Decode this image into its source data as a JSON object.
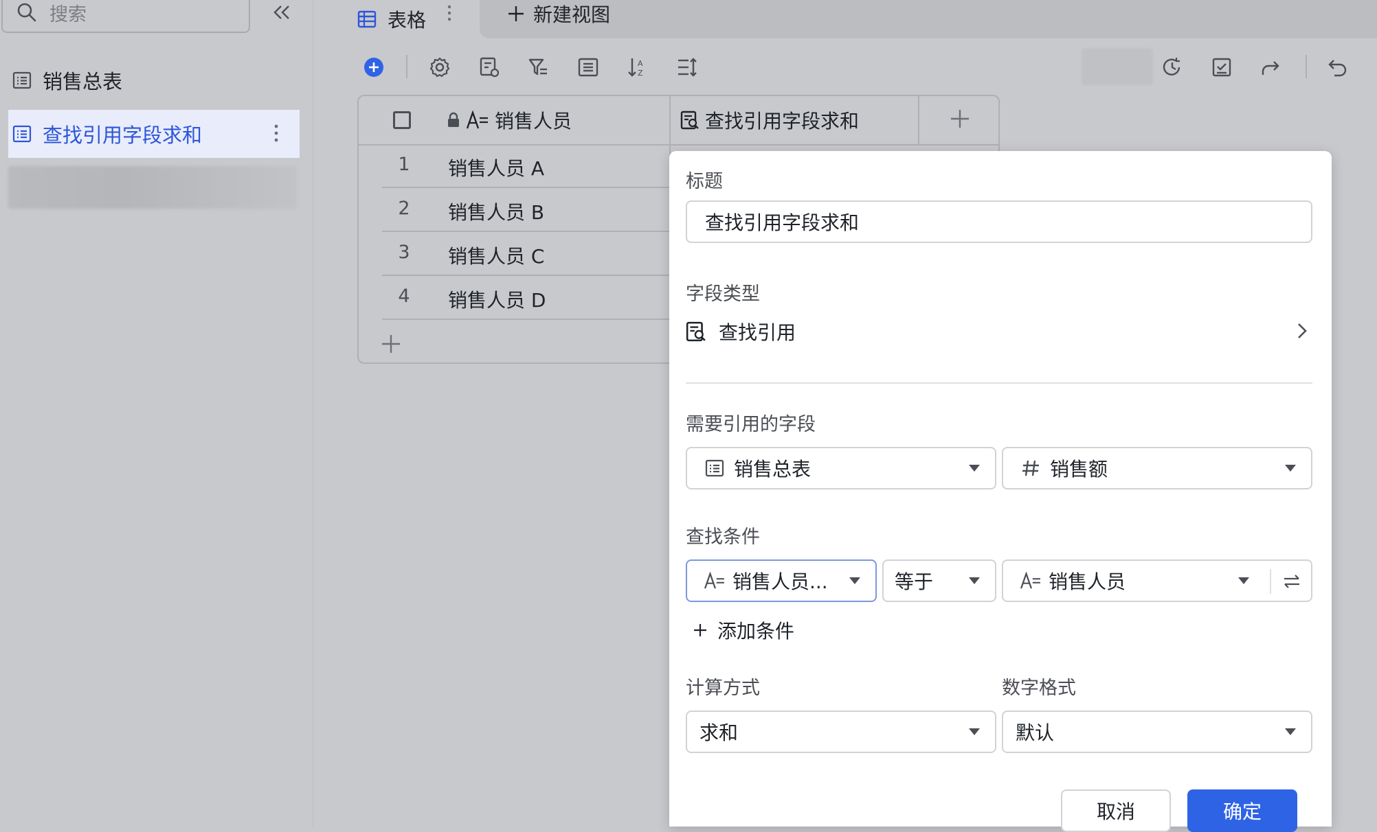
{
  "sidebar": {
    "search_placeholder": "搜索",
    "items": [
      {
        "label": "销售总表",
        "icon": "table-icon"
      },
      {
        "label": "查找引用字段求和",
        "icon": "table-icon",
        "selected": true
      }
    ]
  },
  "view_tabs": {
    "active_tab": "表格",
    "new_view_label": "新建视图"
  },
  "grid": {
    "columns": [
      {
        "label": "销售人员",
        "icon": "text-field-icon",
        "locked": true
      },
      {
        "label": "查找引用字段求和",
        "icon": "lookup-icon"
      }
    ],
    "rows": [
      {
        "num": "1",
        "value": "销售人员 A"
      },
      {
        "num": "2",
        "value": "销售人员 B"
      },
      {
        "num": "3",
        "value": "销售人员 C"
      },
      {
        "num": "4",
        "value": "销售人员 D"
      }
    ]
  },
  "panel": {
    "title_label": "标题",
    "title_value": "查找引用字段求和",
    "field_type_label": "字段类型",
    "field_type_value": "查找引用",
    "ref_field_label": "需要引用的字段",
    "ref_table": "销售总表",
    "ref_field": "销售额",
    "find_condition_label": "查找条件",
    "condition": {
      "field": "销售人员...",
      "operator": "等于",
      "value": "销售人员"
    },
    "add_condition_label": "添加条件",
    "calc_label": "计算方式",
    "calc_value": "求和",
    "number_format_label": "数字格式",
    "number_format_value": "默认",
    "cancel_label": "取消",
    "ok_label": "确定"
  },
  "colors": {
    "accent": "#2f63e6",
    "selected_bg": "#e9edfb",
    "dim_bg": "#c8c9cc"
  }
}
